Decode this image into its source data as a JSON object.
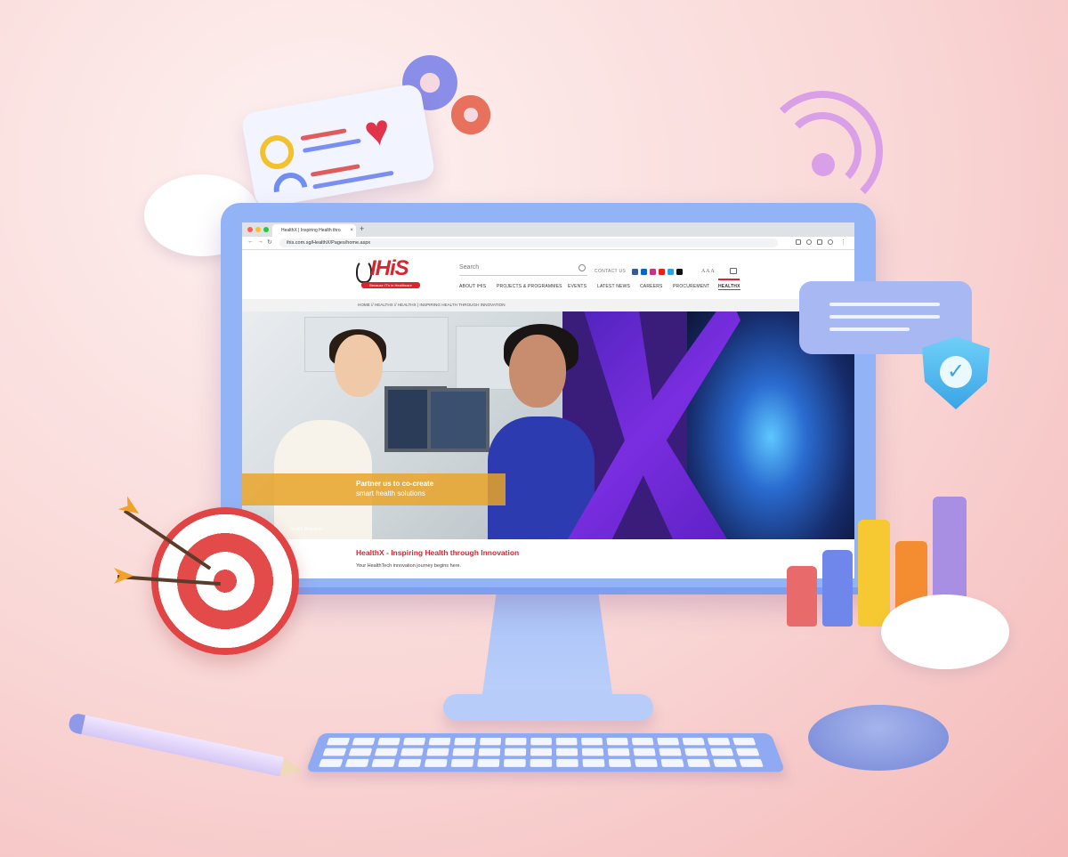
{
  "browser": {
    "tab_title": "HealthX | Inspiring Health thro",
    "tab_close": "×",
    "new_tab": "+",
    "url": "ihis.com.sg/HealthX/Pages/home.aspx",
    "back": "←",
    "forward": "→",
    "reload": "↻"
  },
  "site": {
    "logo_text": "IHiS",
    "logo_tagline": "Because IT's in Healthcare",
    "search_placeholder": "Search",
    "contact_label": "CONTACT US",
    "font_size_label": "A A A",
    "nav": [
      "ABOUT IHIS",
      "PROJECTS & PROGRAMMES",
      "EVENTS",
      "LATEST NEWS",
      "CAREERS",
      "PROCUREMENT",
      "HEALTHX"
    ],
    "breadcrumb": "HOME // HEALTHX // HEALTHX | INSPIRING HEALTH THROUGH INNOVATION",
    "hero_line1": "Partner us to co-create",
    "hero_line2": "smart health solutions",
    "hero_caption": "Health Polyclinic",
    "page_heading": "HealthX - Inspiring Health through Innovation",
    "page_subheading": "Your HealthTech innovation journey begins here."
  },
  "colors": {
    "brand_red": "#d8262f",
    "monitor_blue": "#93b3f7",
    "banner_orange": "#e8a528",
    "hero_purple": "#5a1fc0"
  },
  "social_icons": [
    "facebook-icon",
    "linkedin-icon",
    "instagram-icon",
    "youtube-icon",
    "telegram-icon",
    "tiktok-icon"
  ]
}
